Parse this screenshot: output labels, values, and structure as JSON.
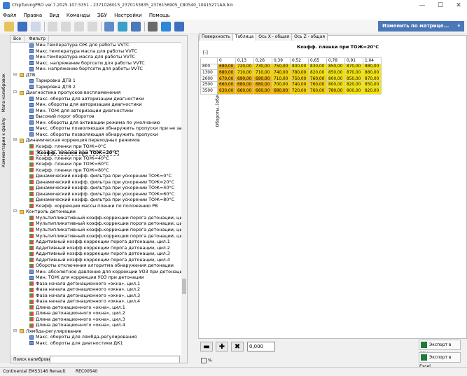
{
  "window": {
    "title": "ChipTuningPRO ver.7.2025.107.5351 - 2371026015_2370153835_2376156905_C80540_10415271AA.bin"
  },
  "menu": [
    "Файл",
    "Правка",
    "Вид",
    "Команды",
    "ЭБУ",
    "Настройки",
    "Помощь"
  ],
  "toolbar": {
    "change_matrix": "Изменить по матрице..."
  },
  "sidebar": {
    "calib_map": "Мапа калибровок",
    "comments": "Комментарии к файлу"
  },
  "tree_tabs": [
    "Все",
    "Фильтр"
  ],
  "tree": [
    {
      "indent": 2,
      "icon": "table",
      "label": "Мин.температура ОЖ для работы VVTC"
    },
    {
      "indent": 2,
      "icon": "table",
      "label": "Макс.температура масла для работы VVTC"
    },
    {
      "indent": 2,
      "icon": "table",
      "label": "Мин.температура масла для работы VVTC"
    },
    {
      "indent": 2,
      "icon": "table",
      "label": "Макс. напряжение бортсети для работы VVTC"
    },
    {
      "indent": 2,
      "icon": "table",
      "label": "Мин. напряжение бортсети для работы VVTC"
    },
    {
      "indent": 1,
      "icon": "folder",
      "exp": "−",
      "label": "ДТВ"
    },
    {
      "indent": 2,
      "icon": "table",
      "label": "Тарировка ДТВ 1"
    },
    {
      "indent": 2,
      "icon": "table",
      "label": "Тарировка ДТВ 2"
    },
    {
      "indent": 1,
      "icon": "folder",
      "exp": "−",
      "label": "Диагностика пропусков воспламенения"
    },
    {
      "indent": 2,
      "icon": "table",
      "label": "Макс. обороты для авторизации диагностики"
    },
    {
      "indent": 2,
      "icon": "table",
      "label": "Мин. обороты для авторизации диагностики"
    },
    {
      "indent": 2,
      "icon": "table",
      "label": "Мин. ТОЖ для авторизации диагностики"
    },
    {
      "indent": 2,
      "icon": "table",
      "label": "Высокий порог оборотов"
    },
    {
      "indent": 2,
      "icon": "table",
      "label": "Мин. обороты для активации режима по умолчанию"
    },
    {
      "indent": 2,
      "icon": "table",
      "label": "Макс. обороты  позволяющая обнаружить пропуски при не закрыто"
    },
    {
      "indent": 2,
      "icon": "table",
      "label": "Макс. обороты позволяющая обнаружить пропуски"
    },
    {
      "indent": 1,
      "icon": "folder",
      "exp": "−",
      "label": "Динамическая коррекция переходных режимов"
    },
    {
      "indent": 2,
      "icon": "chart",
      "label": "Коэфф. пленки при ТОЖ=0°C"
    },
    {
      "indent": 2,
      "icon": "chart",
      "label": "Коэфф. пленки при ТОЖ=20°C",
      "sel": true
    },
    {
      "indent": 2,
      "icon": "chart",
      "label": "Коэфф. пленки при ТОЖ=40°C"
    },
    {
      "indent": 2,
      "icon": "chart",
      "label": "Коэфф. пленки при ТОЖ=60°C"
    },
    {
      "indent": 2,
      "icon": "chart",
      "label": "Коэфф. пленки при ТОЖ=80°C"
    },
    {
      "indent": 2,
      "icon": "chart",
      "label": "Динамический коэфф. фильтра при ускорении ТОЖ=0°C"
    },
    {
      "indent": 2,
      "icon": "chart",
      "label": "Динамический коэфф. фильтра при ускорении ТОЖ=20°C"
    },
    {
      "indent": 2,
      "icon": "chart",
      "label": "Динамический коэфф. фильтра при ускорении ТОЖ=40°C"
    },
    {
      "indent": 2,
      "icon": "chart",
      "label": "Динамический коэфф. фильтра при ускорении ТОЖ=60°C"
    },
    {
      "indent": 2,
      "icon": "chart",
      "label": "Динамический коэфф. фильтра при ускорении ТОЖ=80°C"
    },
    {
      "indent": 2,
      "icon": "chart",
      "label": "Коэфф. коррекции массы пленки по положению РВ"
    },
    {
      "indent": 1,
      "icon": "folder",
      "exp": "−",
      "label": "Контроль детонации"
    },
    {
      "indent": 2,
      "icon": "chart",
      "label": "Мультипликативный коэфф.коррекции порога детонации, цил.1"
    },
    {
      "indent": 2,
      "icon": "chart",
      "label": "Мультипликативный коэфф.коррекции порога детонации, цил.2"
    },
    {
      "indent": 2,
      "icon": "chart",
      "label": "Мультипликативный коэфф.коррекции порога детонации, цил.3"
    },
    {
      "indent": 2,
      "icon": "chart",
      "label": "Мультипликативный коэфф.коррекции порога детонации, цил.4"
    },
    {
      "indent": 2,
      "icon": "chart",
      "label": "Аддитивный коэфф.коррекции порога детонации, цил.1"
    },
    {
      "indent": 2,
      "icon": "chart",
      "label": "Аддитивный коэфф.коррекции порога детонации, цил.2"
    },
    {
      "indent": 2,
      "icon": "chart",
      "label": "Аддитивный коэфф.коррекции порога детонации, цил.3"
    },
    {
      "indent": 2,
      "icon": "chart",
      "label": "Аддитивный коэфф.коррекции порога детонации, цил.4"
    },
    {
      "indent": 2,
      "icon": "chart",
      "label": "Обороты отключения алгоритма обнаружения детонации"
    },
    {
      "indent": 2,
      "icon": "table",
      "label": "Мин. абсолютное давление для коррекции УОЗ при детонации"
    },
    {
      "indent": 2,
      "icon": "table",
      "label": "Мин. ТОЖ для коррекции УОЗ при детонации"
    },
    {
      "indent": 2,
      "icon": "chart",
      "label": "Фаза начала детонационного «окна», цил.1"
    },
    {
      "indent": 2,
      "icon": "chart",
      "label": "Фаза начала детонационного «окна», цил.2"
    },
    {
      "indent": 2,
      "icon": "chart",
      "label": "Фаза начала детонационного «окна», цил.3"
    },
    {
      "indent": 2,
      "icon": "chart",
      "label": "Фаза начала детонационного «окна», цил.4"
    },
    {
      "indent": 2,
      "icon": "chart",
      "label": "Длина детонационного «окна», цил.1"
    },
    {
      "indent": 2,
      "icon": "chart",
      "label": "Длина детонационного «окна», цил.2"
    },
    {
      "indent": 2,
      "icon": "chart",
      "label": "Длина детонационного «окна», цил.3"
    },
    {
      "indent": 2,
      "icon": "chart",
      "label": "Длина детонационного «окна», цил.4"
    },
    {
      "indent": 1,
      "icon": "folder",
      "exp": "−",
      "label": "Лямбда-регулирование"
    },
    {
      "indent": 2,
      "icon": "table",
      "label": "Макс. обороты для лямбда-регулирования"
    },
    {
      "indent": 2,
      "icon": "table",
      "label": "Макс. обороты для диагностики ДК1"
    }
  ],
  "search": {
    "label": "Поиск калибровки"
  },
  "right_tabs": [
    "Поверхность",
    "Таблица",
    "Ось X - общая",
    "Ось Z - общая"
  ],
  "map": {
    "title": "Коэфф. пленки при ТОЖ=20°C",
    "unit": "[-]",
    "ylabel": "Обороты, [об/мин]",
    "columns": [
      "0",
      "0,13",
      "0,26",
      "0,39",
      "0,52",
      "0,65",
      "0,78",
      "0,91",
      "1,04"
    ],
    "rows": [
      {
        "rpm": "800",
        "values": [
          "690,00",
          "720,00",
          "730,00",
          "750,00",
          "800,00",
          "830,00",
          "850,00",
          "870,00",
          "880,00"
        ]
      },
      {
        "rpm": "1300",
        "values": [
          "680,00",
          "710,00",
          "710,00",
          "740,00",
          "780,00",
          "820,00",
          "850,00",
          "870,00",
          "880,00"
        ]
      },
      {
        "rpm": "2000",
        "values": [
          "670,00",
          "690,00",
          "690,00",
          "710,00",
          "750,00",
          "760,00",
          "800,00",
          "850,00",
          "870,00"
        ]
      },
      {
        "rpm": "2500",
        "values": [
          "660,00",
          "680,00",
          "680,00",
          "700,00",
          "740,00",
          "760,00",
          "800,00",
          "820,00",
          "850,00"
        ]
      },
      {
        "rpm": "3500",
        "values": [
          "630,00",
          "660,00",
          "660,00",
          "680,00",
          "720,00",
          "760,00",
          "780,00",
          "800,00",
          "820,00"
        ]
      }
    ]
  },
  "bottom": {
    "value": "0,000",
    "pct": "%",
    "export_csv": "Экспорт в CSV",
    "export_excel": "Экспорт в Excel"
  },
  "status": {
    "ecu": "Continental EMS3146 Renault",
    "software": "REC00540"
  }
}
